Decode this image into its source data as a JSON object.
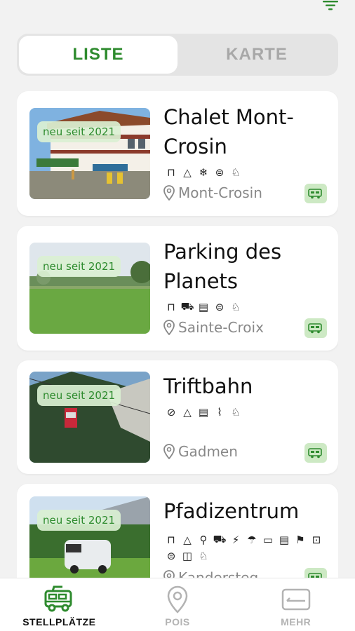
{
  "colors": {
    "accent": "#2e8b2e",
    "badge_bg": "#daf0d2",
    "rv_badge_bg": "#cde9c4",
    "muted": "#a8a8a8"
  },
  "segmented": {
    "tabs": [
      {
        "label": "LISTE",
        "active": true
      },
      {
        "label": "KARTE",
        "active": false
      }
    ]
  },
  "cards": [
    {
      "badge": "neu seit 2021",
      "title": "Chalet Mont-Crosin",
      "location": "Mont-Crosin",
      "amenities": [
        "picnic-table-icon",
        "tent-icon",
        "snowflake-icon",
        "restaurant-icon",
        "dog-icon"
      ]
    },
    {
      "badge": "neu seit 2021",
      "title": "Parking des Planets",
      "location": "Sainte-Croix",
      "amenities": [
        "picnic-table-icon",
        "shopping-cart-icon",
        "trash-icon",
        "restaurant-icon",
        "dog-icon"
      ]
    },
    {
      "badge": "neu seit 2021",
      "title": "Triftbahn",
      "location": "Gadmen",
      "amenities": [
        "no-entry-icon",
        "tent-icon",
        "trash-icon",
        "faucet-icon",
        "dog-icon"
      ]
    },
    {
      "badge": "neu seit 2021",
      "title": "Pfadizentrum",
      "location": "Kandersteg",
      "amenities": [
        "picnic-table-icon",
        "tent-icon",
        "hiking-icon",
        "shopping-cart-icon",
        "plug-icon",
        "shower-icon",
        "sink-icon",
        "trash-icon",
        "flag-icon",
        "washer-icon",
        "restaurant-icon",
        "grill-icon",
        "dog-icon"
      ]
    }
  ],
  "nav": {
    "items": [
      {
        "label": "STELLPLÄTZE",
        "icon": "camper-icon",
        "active": true
      },
      {
        "label": "POIS",
        "icon": "map-pin-icon",
        "active": false
      },
      {
        "label": "MEHR",
        "icon": "more-box-icon",
        "active": false
      }
    ]
  }
}
